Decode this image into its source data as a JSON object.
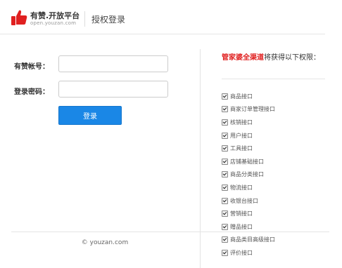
{
  "header": {
    "logo_name": "有赞.开放平台",
    "logo_url": "open.youzan.com",
    "page_title": "授权登录"
  },
  "login": {
    "account_label": "有赞帐号：",
    "account_value": "",
    "password_label": "登录密码：",
    "password_value": "",
    "submit_label": "登录"
  },
  "permissions": {
    "app_name": "管家婆全渠道",
    "intro": "将获得以下权限：",
    "items": [
      {
        "label": "商品接口",
        "checked": true
      },
      {
        "label": "商家订单管理接口",
        "checked": true
      },
      {
        "label": "核销接口",
        "checked": true
      },
      {
        "label": "用户接口",
        "checked": true
      },
      {
        "label": "工具接口",
        "checked": true
      },
      {
        "label": "店铺基础接口",
        "checked": true
      },
      {
        "label": "商品分类接口",
        "checked": true
      },
      {
        "label": "物流接口",
        "checked": true
      },
      {
        "label": "收银台接口",
        "checked": true
      },
      {
        "label": "营销接口",
        "checked": true
      },
      {
        "label": "赠品接口",
        "checked": true
      },
      {
        "label": "商品类目高级接口",
        "checked": true
      },
      {
        "label": "评价接口",
        "checked": true
      }
    ]
  },
  "footer": {
    "copyright": "© youzan.com"
  },
  "colors": {
    "brand_red": "#e02020",
    "button_blue": "#1a87e6"
  }
}
